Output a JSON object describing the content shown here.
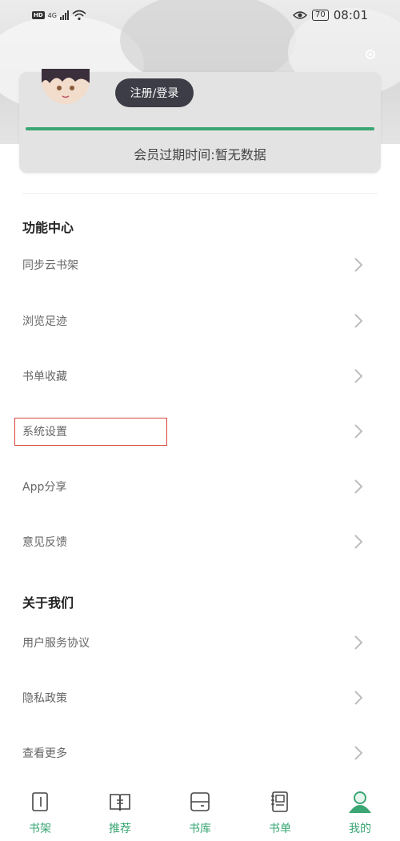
{
  "status_bar": {
    "network_type": "HD",
    "network_gen": "4G",
    "battery_level": "70",
    "time": "08:01"
  },
  "profile": {
    "login_button": "注册/登录",
    "membership_expiry": "会员过期时间:暂无数据",
    "membership_progress": 1.0
  },
  "function_center": {
    "title": "功能中心",
    "items": [
      {
        "label": "同步云书架"
      },
      {
        "label": "浏览足迹"
      },
      {
        "label": "书单收藏"
      },
      {
        "label": "系统设置"
      },
      {
        "label": "App分享"
      },
      {
        "label": "意见反馈"
      }
    ]
  },
  "about_us": {
    "title": "关于我们",
    "items": [
      {
        "label": "用户服务协议"
      },
      {
        "label": "隐私政策"
      },
      {
        "label": "查看更多"
      }
    ]
  },
  "tab_bar": {
    "tabs": [
      {
        "label": "书架",
        "icon": "bookshelf-icon"
      },
      {
        "label": "推荐",
        "icon": "open-book-icon"
      },
      {
        "label": "书库",
        "icon": "library-icon"
      },
      {
        "label": "书单",
        "icon": "notebook-icon"
      },
      {
        "label": "我的",
        "icon": "user-icon"
      }
    ],
    "active_index": 4
  },
  "colors": {
    "accent": "#3aa673",
    "highlight_box": "#d9443a",
    "login_button_bg": "#3c3d47"
  }
}
